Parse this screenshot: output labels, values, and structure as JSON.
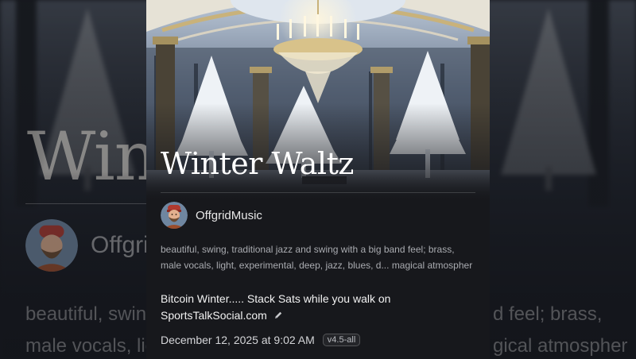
{
  "song": {
    "title": "Winter Waltz",
    "author": "OffgridMusic",
    "description_line1": "beautiful, swing, traditional jazz and swing with a big band feel; brass,",
    "description_line2": "male vocals, light, experimental, deep, jazz, blues, d... magical atmospher",
    "caption_line1": "Bitcoin Winter..... Stack Sats while you walk on",
    "caption_line2": "SportsTalkSocial.com",
    "date": "December 12, 2025 at 9:02 AM",
    "model_badge": "v4.5-all"
  },
  "background": {
    "title_fragment": "Wint",
    "author_fragment": "Offgrid",
    "desc_left_line1": "beautiful, swing",
    "desc_left_line2": "male vocals, ligh",
    "desc_right_line1": "d feel; brass,",
    "desc_right_line2": "gical atmospher"
  },
  "icons": {
    "edit": "pencil-icon",
    "avatar": "bearded-man-avatar"
  },
  "colors": {
    "card_bg": "#17181c",
    "title": "#ffffff",
    "muted_text": "#a9abb0"
  }
}
